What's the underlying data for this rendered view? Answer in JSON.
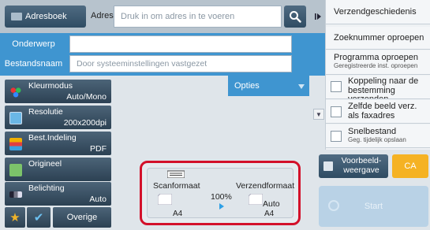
{
  "header": {
    "address_book_label": "Adresboek",
    "address_label": "Adres",
    "address_placeholder": "Druk in om adres in te voeren"
  },
  "form": {
    "subject_label": "Onderwerp",
    "subject_value": "",
    "filename_label": "Bestandsnaam",
    "filename_placeholder": "Door systeeminstellingen vastgezet"
  },
  "options_label": "Opties",
  "settings": [
    {
      "label": "Kleurmodus",
      "value": "Auto/Mono",
      "icon": "color-mode-icon"
    },
    {
      "label": "Resolutie",
      "value": "200x200dpi",
      "icon": "resolution-icon"
    },
    {
      "label": "Best.Indeling",
      "value": "PDF",
      "icon": "file-format-icon"
    },
    {
      "label": "Origineel",
      "value": "",
      "icon": "original-icon"
    },
    {
      "label": "Belichting",
      "value": "Auto",
      "icon": "exposure-icon"
    }
  ],
  "bottom": {
    "other_label": "Overige"
  },
  "scan": {
    "scan_size_label": "Scanformaat",
    "send_size_label": "Verzendformaat",
    "ratio": "100%",
    "scan_paper": "A4",
    "send_mode": "Auto",
    "send_paper": "A4"
  },
  "sidebar": {
    "send_history": "Verzendgeschiedenis",
    "recall_search": "Zoeknummer oproepen",
    "recall_program": "Programma oproepen",
    "recall_program_sub": "Geregistreerde inst. oproepen",
    "link_dest": "Koppeling naar de bestemming verzenden",
    "same_image": "Zelfde beeld verz. als faxadres",
    "quick_file": "Snelbestand",
    "quick_file_sub": "Geg. tijdelijk opslaan"
  },
  "actions": {
    "preview_label": "Voorbeeld-weergave",
    "ca_label": "CA",
    "start_label": "Start"
  },
  "colors": {
    "accent_blue": "#3f95d0",
    "highlight_red": "#d3102a",
    "ca_orange": "#f5b223"
  }
}
